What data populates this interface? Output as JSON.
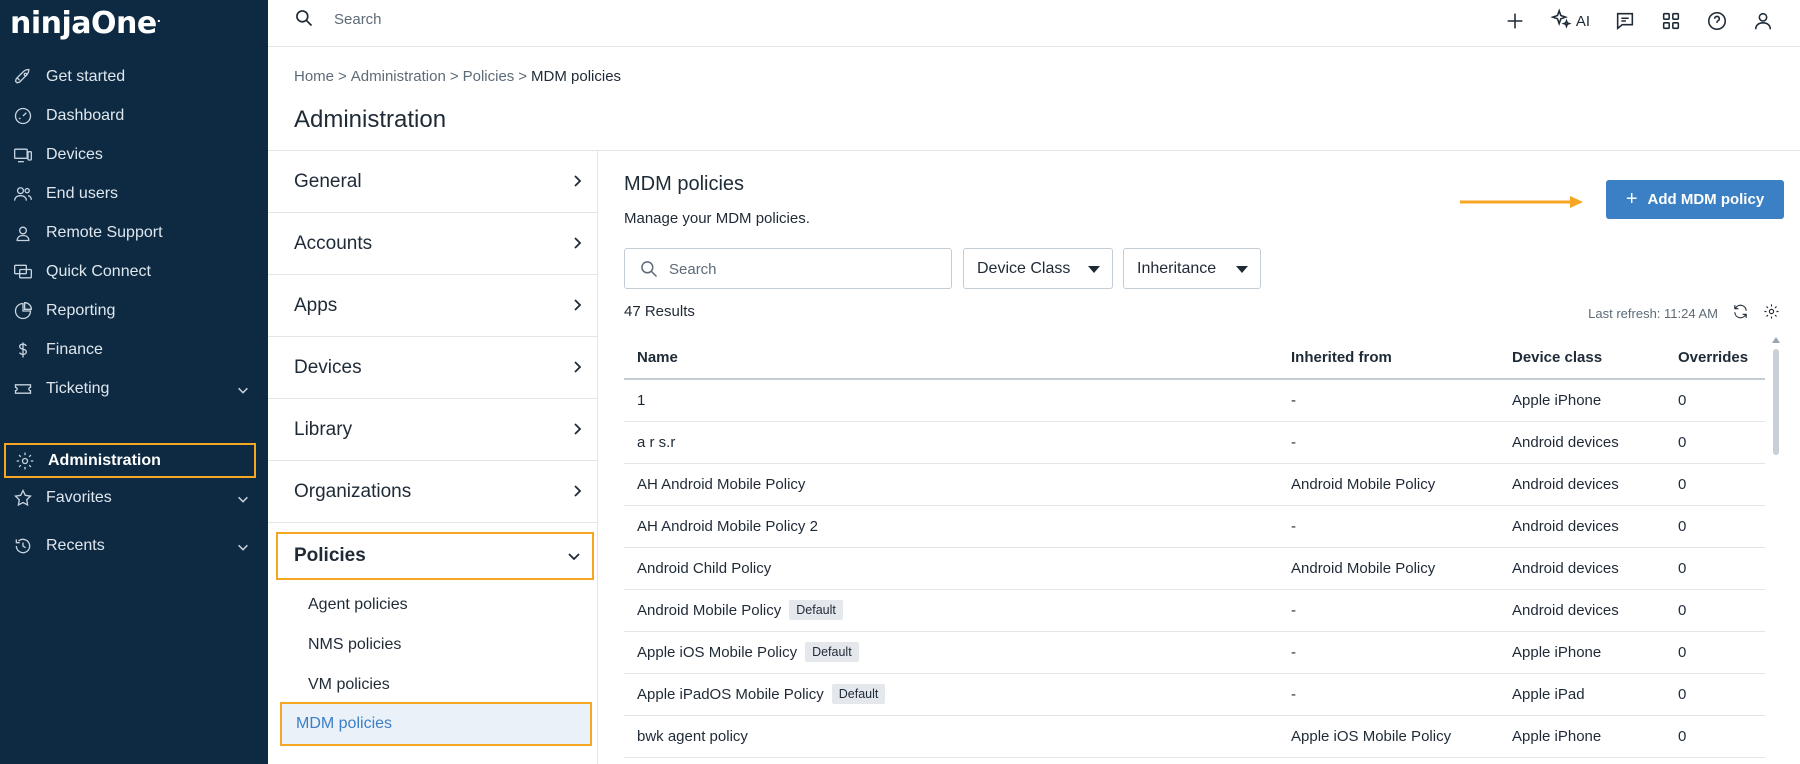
{
  "app": {
    "logo": "ninjaOne",
    "logo_mark": "."
  },
  "sidebar": {
    "items": [
      {
        "label": "Get started",
        "icon": "rocket-icon"
      },
      {
        "label": "Dashboard",
        "icon": "gauge-icon"
      },
      {
        "label": "Devices",
        "icon": "devices-icon"
      },
      {
        "label": "End users",
        "icon": "users-icon"
      },
      {
        "label": "Remote Support",
        "icon": "headset-icon"
      },
      {
        "label": "Quick Connect",
        "icon": "quick-connect-icon"
      },
      {
        "label": "Reporting",
        "icon": "pie-chart-icon"
      },
      {
        "label": "Finance",
        "icon": "dollar-icon"
      },
      {
        "label": "Ticketing",
        "icon": "ticket-icon",
        "expandable": true
      },
      {
        "label": "Administration",
        "icon": "gear-icon",
        "active": true
      },
      {
        "label": "Favorites",
        "icon": "star-icon",
        "expandable": true
      },
      {
        "label": "Recents",
        "icon": "history-icon",
        "expandable": true
      }
    ]
  },
  "topbar": {
    "search_placeholder": "Search",
    "ai_label": "AI",
    "icons": [
      "plus-icon",
      "sparkle-icon",
      "chat-icon",
      "apps-grid-icon",
      "help-icon",
      "user-icon"
    ]
  },
  "breadcrumb": {
    "items": [
      "Home",
      "Administration",
      "Policies"
    ],
    "current": "MDM policies",
    "separator": ">"
  },
  "page_title": "Administration",
  "admin_nav": {
    "items": [
      {
        "label": "General"
      },
      {
        "label": "Accounts"
      },
      {
        "label": "Apps"
      },
      {
        "label": "Devices"
      },
      {
        "label": "Library"
      },
      {
        "label": "Organizations"
      },
      {
        "label": "Policies",
        "open": true
      }
    ],
    "policy_subitems": [
      "Agent policies",
      "NMS policies",
      "VM policies",
      "MDM policies"
    ],
    "active_subitem": "MDM policies"
  },
  "content": {
    "title": "MDM policies",
    "description": "Manage your MDM policies.",
    "add_button": {
      "label": "Add MDM policy",
      "plus": "+"
    },
    "search_placeholder": "Search",
    "filters": [
      "Device Class",
      "Inheritance"
    ],
    "results": "47 Results",
    "last_refresh": "Last refresh: 11:24 AM",
    "highlight_color": "#f5a623",
    "accent_color": "#3b7fc4"
  },
  "table": {
    "columns": [
      "Name",
      "Inherited from",
      "Device class",
      "Overrides"
    ],
    "rows": [
      {
        "name": "1",
        "badge": "",
        "inherited": "-",
        "device_class": "Apple iPhone",
        "overrides": "0"
      },
      {
        "name": "a r s.r",
        "badge": "",
        "inherited": "-",
        "device_class": "Android devices",
        "overrides": "0"
      },
      {
        "name": "AH Android Mobile Policy",
        "badge": "",
        "inherited": "Android Mobile Policy",
        "device_class": "Android devices",
        "overrides": "0"
      },
      {
        "name": "AH Android Mobile Policy 2",
        "badge": "",
        "inherited": "-",
        "device_class": "Android devices",
        "overrides": "0"
      },
      {
        "name": "Android Child Policy",
        "badge": "",
        "inherited": "Android Mobile Policy",
        "device_class": "Android devices",
        "overrides": "0"
      },
      {
        "name": "Android Mobile Policy",
        "badge": "Default",
        "inherited": "-",
        "device_class": "Android devices",
        "overrides": "0"
      },
      {
        "name": "Apple iOS Mobile Policy",
        "badge": "Default",
        "inherited": "-",
        "device_class": "Apple iPhone",
        "overrides": "0"
      },
      {
        "name": "Apple iPadOS Mobile Policy",
        "badge": "Default",
        "inherited": "-",
        "device_class": "Apple iPad",
        "overrides": "0"
      },
      {
        "name": "bwk agent policy",
        "badge": "",
        "inherited": "Apple iOS Mobile Policy",
        "device_class": "Apple iPhone",
        "overrides": "0"
      }
    ]
  }
}
